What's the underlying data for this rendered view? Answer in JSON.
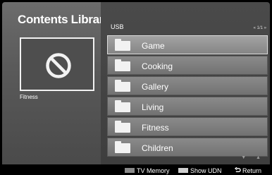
{
  "header": {
    "title": "Contents Library"
  },
  "preview": {
    "label": "Fitness",
    "icon": "no-entry-icon"
  },
  "browser": {
    "source": "USB",
    "page_indicator": "« 1/1 »",
    "items": [
      {
        "label": "Game",
        "icon": "folder-icon",
        "selected": true
      },
      {
        "label": "Cooking",
        "icon": "folder-icon",
        "selected": false
      },
      {
        "label": "Gallery",
        "icon": "folder-icon",
        "selected": false
      },
      {
        "label": "Living",
        "icon": "folder-icon",
        "selected": false
      },
      {
        "label": "Fitness",
        "icon": "folder-icon",
        "selected": false
      },
      {
        "label": "Children",
        "icon": "folder-icon",
        "selected": false
      }
    ],
    "scroll_arrows": "▼ ▲"
  },
  "footer": {
    "tv_memory_label": "TV Memory",
    "tv_memory_key_color": "#8a8a8a",
    "show_udn_label": "Show UDN",
    "show_udn_key_color": "#cfcfcf",
    "return_icon": "return-icon",
    "return_label": "Return"
  }
}
